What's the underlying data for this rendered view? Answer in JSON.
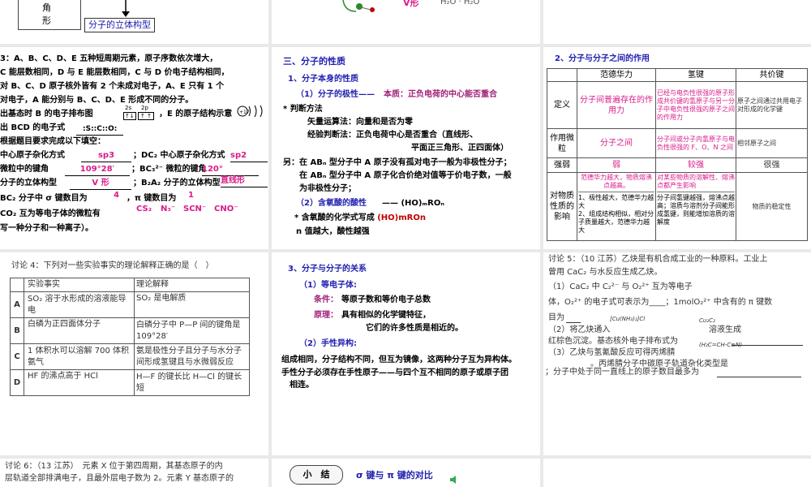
{
  "tl": {
    "char1": "角",
    "char2": "形",
    "box_label": "分子的立体构型"
  },
  "tm": {
    "v_label": "V形",
    "formula": "H₂O · H₂O"
  },
  "ml": {
    "lines": [
      "3：A、B、C、D、E 五种短周期元素，原子序数依次增大，",
      "C 能层数相同，D 与 E 能层数相同，C 与 D 价电子结构相同，",
      "对 B、C、D 原子核外皆有 2 个未成对电子，A、E 只有 1 个",
      "对电子，A 能分别与 B、C、D、E 形成不同的分子。",
      "出基态时 B 的电子排布图",
      "，E 的原子结构示意",
      "出 BCD 的电子式",
      "根据题目要求完成以下填空：",
      "中心原子杂化方式",
      "；DC₂ 中心原子杂化方式",
      "微粒中的键角",
      "；BC₃²⁻ 微粒的键角",
      "分子的立体构型",
      "；B₂A₂ 分子的立体构型",
      "BC₂ 分子中 σ 键数目为",
      "，π 键数目为",
      "CO₂ 互为等电子体的微粒有",
      "写一种分子和一种离子）。"
    ],
    "electron_formula": ":S::C::O:",
    "answers": {
      "hyb1": "sp3",
      "hyb2": "sp2",
      "angle1": "109°28′",
      "angle2": "120°",
      "shape1": "V 形",
      "shape2": "直线形",
      "sigma": "4",
      "pi": "1",
      "iso": [
        "CS₂",
        "N₃⁻",
        "SCN⁻",
        "CNO⁻"
      ]
    },
    "orbital_labels": [
      "2s",
      "2p"
    ],
    "orbital_boxes": [
      "↑↓",
      "↑ ↑"
    ]
  },
  "mm": {
    "heading": "三、分子的性质",
    "sub1": "1、分子本身的性质",
    "item1_label": "（1）分子的极性——",
    "item1_def": "本质：正负电荷的中心能否重合",
    "judge": "* 判断方法",
    "method1": "矢量运算法：向量和是否为零",
    "method2": "经验判断法：正负电荷中心是否重合（直线形、",
    "method2b": "平面正三角形、正四面体）",
    "abn1": "另：在 ABₙ 型分子中 A 原子没有孤对电子一般为非极性分子；",
    "abn2": "在 ABₙ 型分子中 A 原子化合价绝对值等于价电子数，一般",
    "abn3": "为非极性分子；",
    "item2_label": "（2）含氧酸的酸性",
    "item2_def": "—— (HO)ₘROₙ",
    "item2_note_pre": "* 含氧酸的化学式写成 ",
    "item2_note_hl": "(HO)mROn",
    "item2_note3": "n 值越大，酸性越强"
  },
  "mr": {
    "title": "2、分子与分子之间的作用",
    "headers": [
      "",
      "范德华力",
      "氢键",
      "共价键"
    ],
    "rows": [
      {
        "label": "定义",
        "c1": "分子间普遍存在的作用力",
        "c2": "已经与电负性很强的原子形成共价键的氢原子与另一分子中电负性很强的原子之间的作用力",
        "c3": "原子之间通过共用电子对形成的化学键"
      },
      {
        "label": "作用微粒",
        "c1": "分子之间",
        "c2": "分子间或分子内氢原子与电负性很强的 F、O、N 之间",
        "c3": "相邻原子之间"
      },
      {
        "label": "强弱",
        "c1": "弱",
        "c2": "较强",
        "c3": "很强"
      }
    ],
    "impact_label": "对物质性质的影响",
    "impact_c1_top": "范德华力越大，物质熔沸点越高。",
    "impact_c1_list": "1、极性越大，范德华力越大\n2、组成结构相似，相对分子质量越大，范德华力越大",
    "impact_c2_top": "对某些物质的溶解性、熔沸点都产生影响",
    "impact_c2_bottom": "分子间氢键越强，熔沸点越高；溶质与溶剂分子间能形成氢键，则能增加溶质的溶解度",
    "impact_c3": "物质的稳定性"
  },
  "bl": {
    "title": "讨论 4：下列对一些实验事实的理论解释正确的是（　）",
    "headers": [
      "",
      "实验事实",
      "理论解释"
    ],
    "rows": [
      {
        "opt": "A",
        "fact": "SO₂ 溶于水形成的溶液能导电",
        "theory": "SO₂ 是电解质"
      },
      {
        "opt": "B",
        "fact": "白磷为正四面体分子",
        "theory": "白磷分子中 P—P 间的键角是 109°28′"
      },
      {
        "opt": "C",
        "fact": "1 体积水可以溶解 700 体积氨气",
        "theory": "氨是极性分子且分子与水分子间形成氢键且与水微弱反应"
      },
      {
        "opt": "D",
        "fact": "HF 的沸点高于 HCl",
        "theory": "H—F 的键长比 H—Cl 的键长短"
      }
    ]
  },
  "bm": {
    "heading": "3、分子与分子的关系",
    "sub1": "（1）等电子体:",
    "cond_label": "条件：",
    "cond": "等原子数和等价电子总数",
    "principle_label": "原理：",
    "principle": "具有相似的化学键特征，",
    "principle2": "它们的许多性质是相近的。",
    "sub2": "（2）手性异构:",
    "line1": "组成相同，分子结构不同，但互为镜像，这两种分子互为异构体。",
    "line2": "手性分子必须存在手性原子——与四个互不相同的原子或原子团",
    "line3": "相连。"
  },
  "br": {
    "line1": "讨论 5：（10 江苏）乙炔是有机合成工业的一种原料。工业上",
    "line2": "曾用 CaC₂ 与水反应生成乙炔。",
    "line3": "（1）CaC₂ 中 C₂²⁻ 与 O₂²⁺ 互为等电子",
    "line4": "体，O₂²⁺ 的电子式可表示为____；1molO₂²⁺ 中含有的 π 键数",
    "line5": "目为",
    "line6": "（2）将乙炔通入",
    "line7": "红棕色沉淀。基态核外电子排布式为",
    "line8": "（3）乙炔与氢氰酸反应可得丙烯腈",
    "line9": "。丙烯腈分子中碳原子轨道杂化类型是",
    "line10": "；分子中处于同一直线上的原子数目最多为",
    "reagent1": "[Cu(NH₃)₂]Cl",
    "reagent2": "Cu₂C₂",
    "reagent3": "溶液生成",
    "acrylo": "(H₂C=CH-C≡N)"
  },
  "xl": {
    "line1": "讨论 6：（13 江苏）　元素 X 位于第四周期，其基态原子的内",
    "line2": "层轨道全部排满电子，且最外层电子数为 2。元素 Y 基态原子的"
  },
  "xm": {
    "box": "小　结",
    "title": "σ 键与 π 键的对比"
  }
}
